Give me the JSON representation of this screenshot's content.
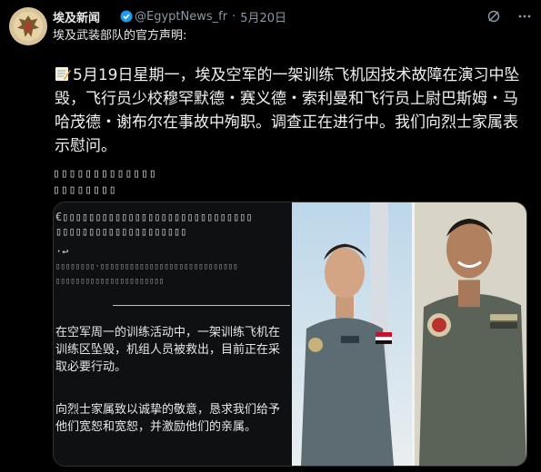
{
  "post": {
    "author": "埃及新闻",
    "handle": "@EgyptNews_fr",
    "separator": "·",
    "date": "5月20日",
    "subtitle": "埃及武装部队的官方声明:",
    "body": "5月19日星期一，埃及空军的一架训练飞机因技术故障在演习中坠毁，飞行员少校穆罕默德・赛义德・索利曼和飞行员上尉巴斯姆・马哈茂德・谢布尔在事故中殉职。调查正在进行中。我们向烈士家属表示慰问。",
    "garbled_line1": "▯▯▯▯▯▯▯▯▯▯▯▯▯",
    "garbled_line2": "▯▯▯▯▯▯▯▯"
  },
  "card": {
    "garbled_a": "€▯▯▯▯▯▯▯▯▯▯▯▯▯▯▯▯▯▯▯▯▯▯▯▯▯▯▯▯▯\n▯▯▯▯▯▯▯▯▯▯▯▯▯▯▯▯▯▯▯▯",
    "garbled_b": "·↩",
    "garbled_c": "▯▯▯▯▯▯▯▯·▯▯▯▯▯▯▯▯▯▯▯▯▯▯▯▯▯▯▯▯▯▯▯▯▯▯▯▯\n▯▯▯▯▯▯▯▯▯▯▯▯▯▯▯▯▯▯▯▯▯▯",
    "para1": "在空军周一的训练活动中，一架训练飞机在训练区坠毁，机组人员被救出，目前正在采取必要行动。",
    "para2": "向烈士家属致以诚挚的敬意，恳求我们给予他们宽恕和宽恕，并激励他们的亲属。"
  },
  "icons": {
    "avatar": "eagle-emblem-icon",
    "badge": "verified-badge-icon",
    "grok": "grok-icon",
    "more": "more-icon",
    "memo": "memo-icon"
  },
  "colors": {
    "background": "#000000",
    "text": "#e7e9ea",
    "muted": "#8b98a5",
    "badge": "#1d9bf0"
  }
}
